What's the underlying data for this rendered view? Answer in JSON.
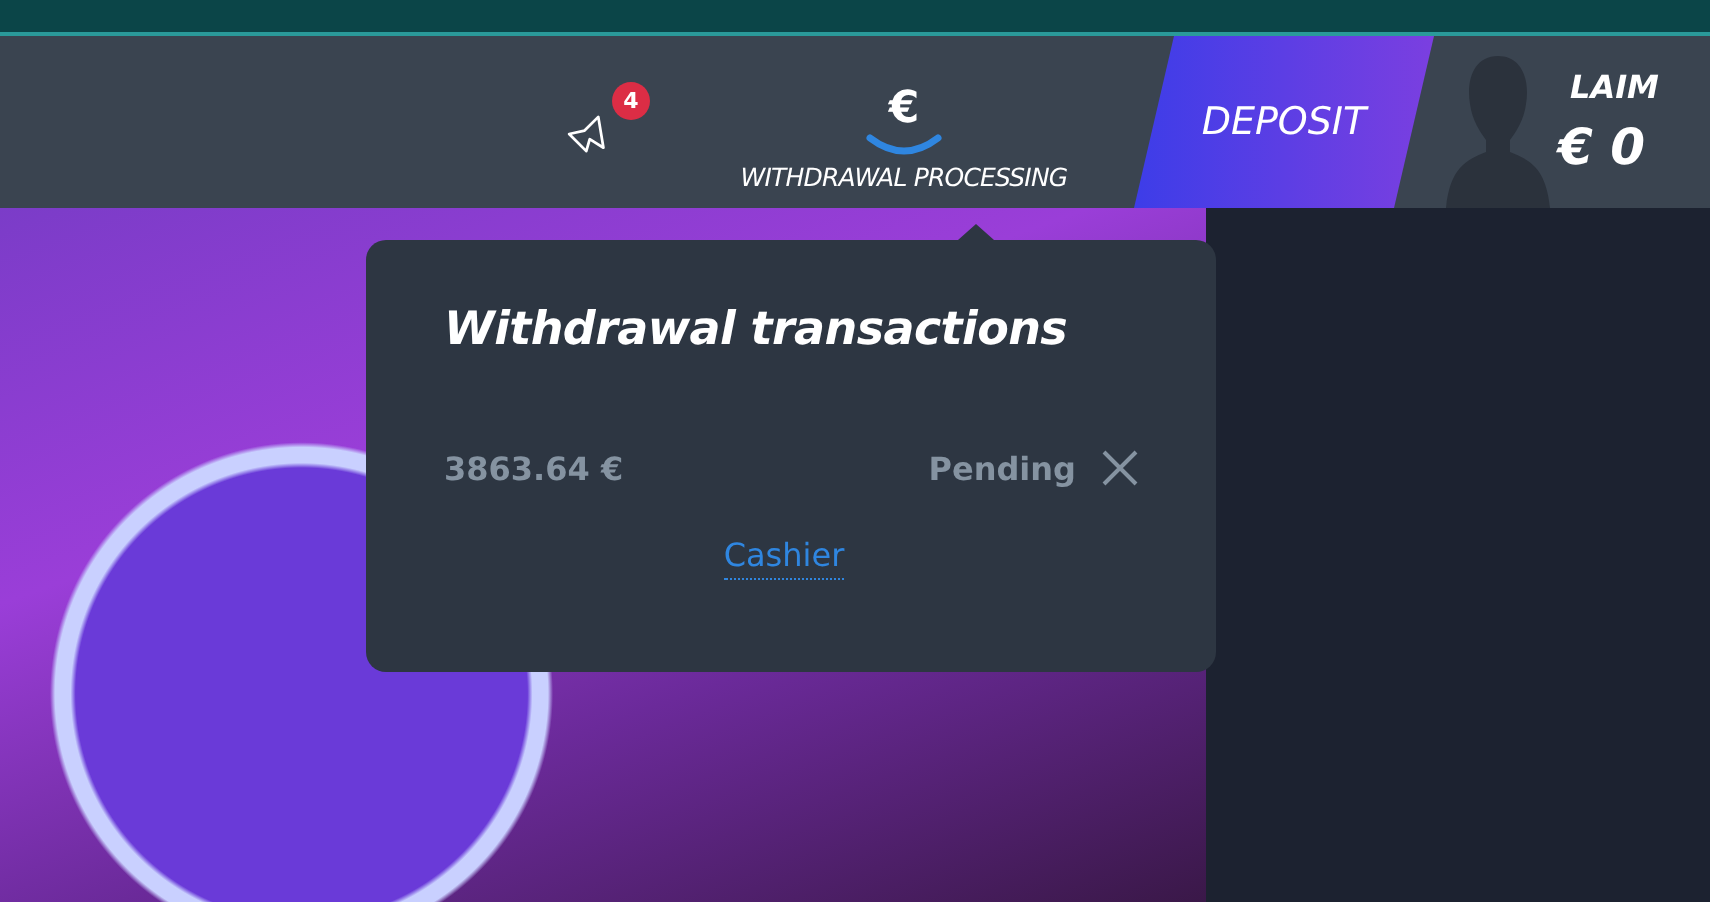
{
  "notifications": {
    "count": "4"
  },
  "withdrawal_status": {
    "icon": "€",
    "label": "WITHDRAWAL PROCESSING"
  },
  "deposit_button": {
    "label": "DEPOSIT"
  },
  "user": {
    "name": "LAIM",
    "balance": "€ 0"
  },
  "popover": {
    "title": "Withdrawal transactions",
    "transactions": [
      {
        "amount": "3863.64 €",
        "status": "Pending"
      }
    ],
    "link": "Cashier"
  }
}
